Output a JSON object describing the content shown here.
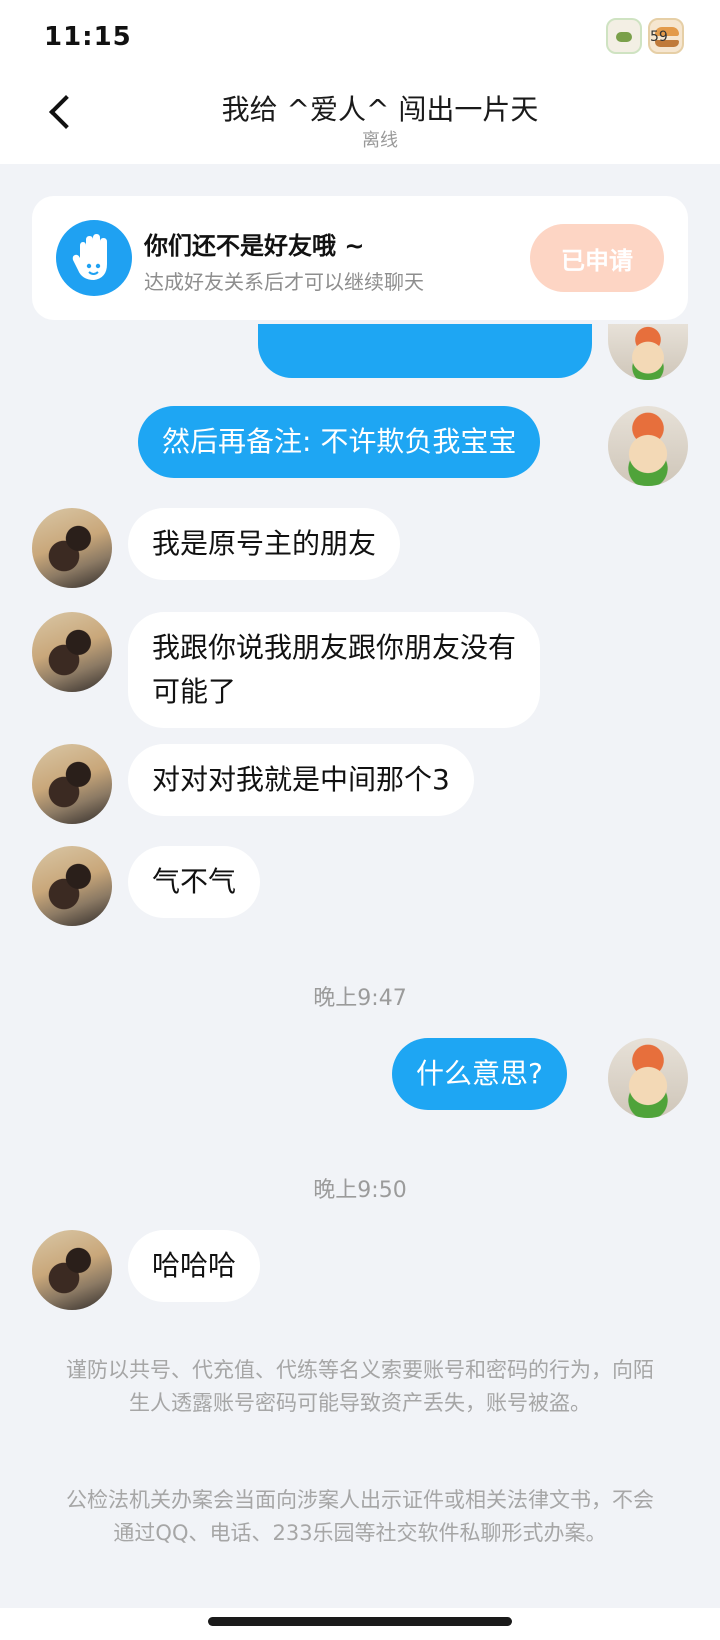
{
  "status_bar": {
    "time": "11:15",
    "battery_text": "59",
    "icons": [
      "cow-sticker-icon",
      "burger-sticker-icon"
    ]
  },
  "header": {
    "title": "我给 ^爱人^ 闯出一片天",
    "status": "离线"
  },
  "friend_card": {
    "title": "你们还不是好友哦 ~",
    "subtitle": "达成好友关系后才可以继续聊天",
    "button": "已申请",
    "button_color": "#fdd5c4",
    "icon_color": "#1fa1f2"
  },
  "messages": [
    {
      "side": "out",
      "lines": [
        "然后再备注: 不许欺负我宝宝"
      ]
    },
    {
      "side": "in",
      "lines": [
        "我是原号主的朋友"
      ]
    },
    {
      "side": "in",
      "lines": [
        "我跟你说我朋友跟你朋友没有",
        "可能了"
      ]
    },
    {
      "side": "in",
      "lines": [
        "对对对我就是中间那个3"
      ]
    },
    {
      "side": "in",
      "lines": [
        "气不气"
      ]
    },
    {
      "timestamp": "晚上9:47"
    },
    {
      "side": "out",
      "lines": [
        "什么意思?"
      ]
    },
    {
      "timestamp": "晚上9:50"
    },
    {
      "side": "in",
      "lines": [
        "哈哈哈"
      ]
    }
  ],
  "notices": [
    "谨防以共号、代充值、代练等名义索要账号和密码的行为，向陌生人透露账号密码可能导致资产丢失，账号被盗。",
    "公检法机关办案会当面向涉案人出示证件或相关法律文书，不会通过QQ、电话、233乐园等社交软件私聊形式办案。"
  ],
  "colors": {
    "outgoing_bubble": "#1ea6f3",
    "incoming_bubble": "#ffffff",
    "background": "#f1f3f7"
  }
}
